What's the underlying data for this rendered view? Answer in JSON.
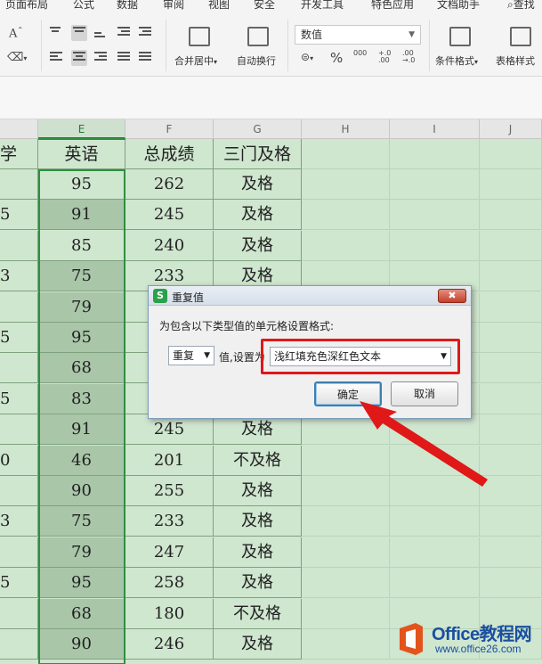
{
  "menu_tabs": [
    "页面布局",
    "公式",
    "数据",
    "审阅",
    "视图",
    "安全",
    "开发工具",
    "特色应用",
    "文档助手",
    "查找"
  ],
  "ribbon": {
    "font_size_glyph": "A",
    "merge_label": "合并居中",
    "wrap_label": "自动换行",
    "number_format": "数值",
    "currency_glyph": "¥",
    "percent_glyph": "%",
    "thousands_glyph": "000",
    "inc_decimal_glyph": "+.0 .00",
    "dec_decimal_glyph": ".00 →.0",
    "cond_format_label": "条件格式",
    "table_style_label": "表格样式"
  },
  "columns": [
    "E",
    "F",
    "G",
    "H",
    "I",
    "J"
  ],
  "table": {
    "headers": {
      "d": "学",
      "e": "英语",
      "f": "总成绩",
      "g": "三门及格"
    },
    "rows": [
      {
        "d": "",
        "e": "95",
        "f": "262",
        "g": "及格"
      },
      {
        "d": "5",
        "e": "91",
        "f": "245",
        "g": "及格"
      },
      {
        "d": "",
        "e": "85",
        "f": "240",
        "g": "及格"
      },
      {
        "d": "3",
        "e": "75",
        "f": "233",
        "g": "及格"
      },
      {
        "d": "",
        "e": "79",
        "f": "",
        "g": ""
      },
      {
        "d": "5",
        "e": "95",
        "f": "",
        "g": ""
      },
      {
        "d": "",
        "e": "68",
        "f": "",
        "g": ""
      },
      {
        "d": "5",
        "e": "83",
        "f": "",
        "g": ""
      },
      {
        "d": "",
        "e": "91",
        "f": "245",
        "g": "及格"
      },
      {
        "d": "0",
        "e": "46",
        "f": "201",
        "g": "不及格"
      },
      {
        "d": "",
        "e": "90",
        "f": "255",
        "g": "及格"
      },
      {
        "d": "3",
        "e": "75",
        "f": "233",
        "g": "及格"
      },
      {
        "d": "",
        "e": "79",
        "f": "247",
        "g": "及格"
      },
      {
        "d": "5",
        "e": "95",
        "f": "258",
        "g": "及格"
      },
      {
        "d": "",
        "e": "68",
        "f": "180",
        "g": "不及格"
      },
      {
        "d": "",
        "e": "90",
        "f": "246",
        "g": "及格"
      }
    ]
  },
  "dialog": {
    "title": "重复值",
    "close_glyph": "✖",
    "description": "为包含以下类型值的单元格设置格式:",
    "type_value": "重复",
    "middle_label": "值,设置为",
    "format_value": "浅红填充色深红色文本",
    "ok_label": "确定",
    "cancel_label": "取消"
  },
  "watermark": {
    "brand": "Office教程网",
    "url": "www.office26.com"
  },
  "colors": {
    "sheet_bg": "#cfe6cf",
    "selection": "#2f8f3f",
    "highlight": "#e01818",
    "brand_blue": "#1a4fa0"
  }
}
